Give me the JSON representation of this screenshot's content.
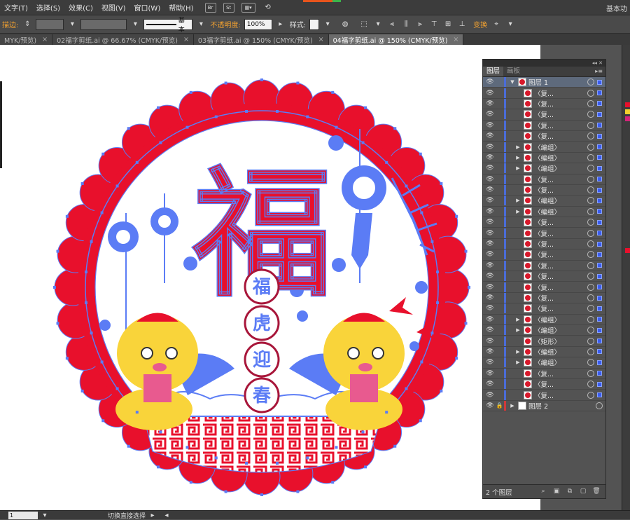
{
  "app": {
    "workspace": "基本功",
    "menus": [
      "文字(T)",
      "选择(S)",
      "效果(C)",
      "视图(V)",
      "窗口(W)",
      "帮助(H)"
    ],
    "menu_icons": [
      "Br",
      "St"
    ]
  },
  "control_bar": {
    "stroke_label": "描边:",
    "stroke_style": "基本",
    "opacity_label": "不透明度:",
    "opacity_value": "100%",
    "style_label": "样式:",
    "transform_label": "变换"
  },
  "tabs": [
    {
      "label": "MYK/预览)",
      "active": false
    },
    {
      "label": "02福字剪纸.ai @ 66.67% (CMYK/预览)",
      "active": false
    },
    {
      "label": "03福字剪纸.ai @ 150% (CMYK/预览)",
      "active": false
    },
    {
      "label": "04福字剪纸.ai @ 150% (CMYK/预览)",
      "active": true
    }
  ],
  "artwork": {
    "main_character": "福",
    "small_characters": [
      "福",
      "虎",
      "迎",
      "春"
    ],
    "colors": {
      "red": "#e8102c",
      "blue_path": "#5b7cf5",
      "yellow": "#f9d43a",
      "pink": "#e85a8f",
      "white": "#ffffff"
    }
  },
  "layers_panel": {
    "tabs": [
      "图层",
      "画板"
    ],
    "rows": [
      {
        "name": "图层 1",
        "type": "layer",
        "expand": "down"
      },
      {
        "name": "〈复...",
        "type": "item",
        "expand": ""
      },
      {
        "name": "〈复...",
        "type": "item",
        "expand": ""
      },
      {
        "name": "〈复...",
        "type": "item",
        "expand": ""
      },
      {
        "name": "〈复...",
        "type": "item",
        "expand": ""
      },
      {
        "name": "〈复...",
        "type": "item",
        "expand": ""
      },
      {
        "name": "〈编组〉",
        "type": "item",
        "expand": "right"
      },
      {
        "name": "〈编组〉",
        "type": "item",
        "expand": "right"
      },
      {
        "name": "〈编组〉",
        "type": "item",
        "expand": "right"
      },
      {
        "name": "〈复...",
        "type": "item",
        "expand": ""
      },
      {
        "name": "〈复...",
        "type": "item",
        "expand": ""
      },
      {
        "name": "〈编组〉",
        "type": "item",
        "expand": "right"
      },
      {
        "name": "〈编组〉",
        "type": "item",
        "expand": "right"
      },
      {
        "name": "〈复...",
        "type": "item",
        "expand": ""
      },
      {
        "name": "〈复...",
        "type": "item",
        "expand": ""
      },
      {
        "name": "〈复...",
        "type": "item",
        "expand": ""
      },
      {
        "name": "〈复...",
        "type": "item",
        "expand": ""
      },
      {
        "name": "〈复...",
        "type": "item",
        "expand": ""
      },
      {
        "name": "〈复...",
        "type": "item",
        "expand": ""
      },
      {
        "name": "〈复...",
        "type": "item",
        "expand": ""
      },
      {
        "name": "〈复...",
        "type": "item",
        "expand": ""
      },
      {
        "name": "〈复...",
        "type": "item",
        "expand": ""
      },
      {
        "name": "〈编组〉",
        "type": "item",
        "expand": "right"
      },
      {
        "name": "〈编组〉",
        "type": "item",
        "expand": "right"
      },
      {
        "name": "〈矩形〉",
        "type": "item",
        "expand": ""
      },
      {
        "name": "〈编组〉",
        "type": "item",
        "expand": "right"
      },
      {
        "name": "〈编组〉",
        "type": "item",
        "expand": "right"
      },
      {
        "name": "〈复...",
        "type": "item",
        "expand": ""
      },
      {
        "name": "〈复...",
        "type": "item",
        "expand": ""
      },
      {
        "name": "〈复...",
        "type": "item",
        "expand": ""
      },
      {
        "name": "图层 2",
        "type": "layer2",
        "expand": "right"
      }
    ],
    "layer_count": "2 个图层"
  },
  "status_bar": {
    "zoom": "1",
    "status_text": "切换直接选择"
  }
}
